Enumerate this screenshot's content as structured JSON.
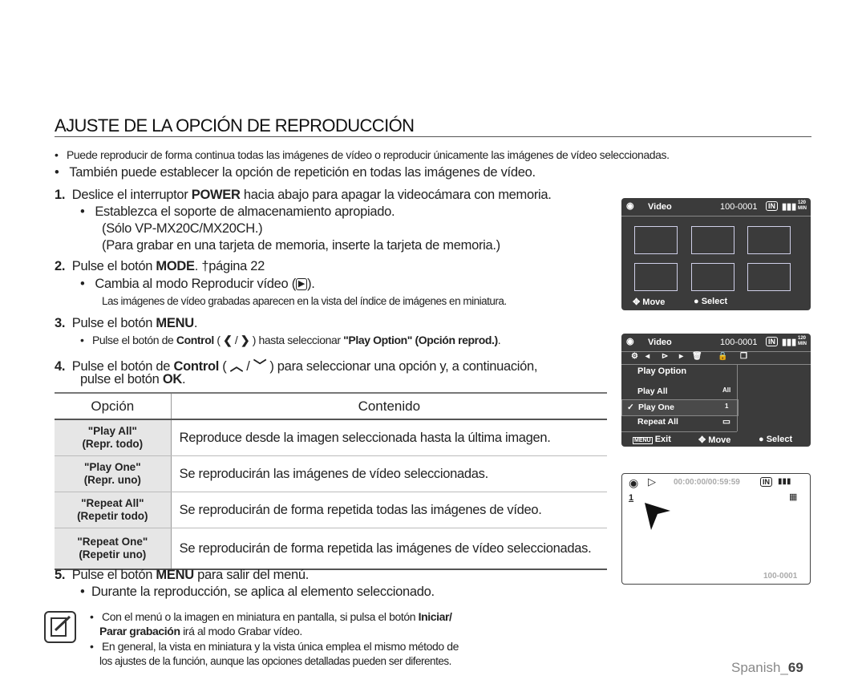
{
  "title": "AJUSTE DE LA OPCIÓN DE REPRODUCCIÓN",
  "intro": [
    "Puede reproducir de forma continua todas las imágenes de vídeo o reproducir únicamente las imágenes de vídeo seleccionadas.",
    "También puede establecer la opción de repetición en todas las imágenes de vídeo."
  ],
  "steps": {
    "s1": {
      "num": "1.",
      "pre": "Deslice el interruptor ",
      "key": "POWER",
      "post": " hacia abajo para apagar la videocámara con memoria.",
      "sub1": "Establezca el soporte de almacenamiento apropiado.",
      "sub2": "(Sólo VP-MX20C/MX20CH.)",
      "sub3": "(Para grabar en una tarjeta de memoria, inserte la tarjeta de memoria.)"
    },
    "s2": {
      "num": "2.",
      "pre": "Pulse el botón ",
      "key": "MODE",
      "post": ".  ",
      "ref": "página 22",
      "sub1": "Cambia al modo Reproducir vídeo (",
      "sub1b": ").",
      "sub2": "Las imágenes de vídeo grabadas aparecen en la vista del índice de imágenes en miniatura."
    },
    "s3": {
      "num": "3.",
      "pre": "Pulse el botón ",
      "key": "MENU",
      "post": ".",
      "sub_pre": "Pulse el botón de ",
      "sub_key": "Control",
      "sub_mid": " ( ",
      "sub_sep": " / ",
      "sub_post": " ) hasta seleccionar ",
      "sub_opt": "\"Play Option\" (Opción reprod.)",
      "sub_end": "."
    },
    "s4": {
      "num": "4.",
      "pre": "Pulse el botón de ",
      "key": "Control",
      "mid": " ( ",
      "sep": " / ",
      "post": " ) para seleccionar una opción y, a continuación,",
      "line2_pre": "pulse el botón ",
      "line2_key": "OK",
      "line2_post": "."
    },
    "s5": {
      "num": "5.",
      "pre": "Pulse el botón ",
      "key": "MENU",
      "post": " para salir del menú.",
      "sub1": "Durante la reproducción, se aplica al elemento seleccionado."
    }
  },
  "table": {
    "headers": [
      "Opción",
      "Contenido"
    ],
    "rows": [
      {
        "opt": "\"Play All\"",
        "opt2": "(Repr. todo)",
        "content": "Reproduce desde la imagen seleccionada hasta la última imagen."
      },
      {
        "opt": "\"Play One\"",
        "opt2": "(Repr. uno)",
        "content": "Se reproducirán las imágenes de vídeo seleccionadas."
      },
      {
        "opt": "\"Repeat All\"",
        "opt2": "(Repetir todo)",
        "content": "Se reproducirán de forma repetida todas las imágenes de vídeo."
      },
      {
        "opt": "\"Repeat One\"",
        "opt2": "(Repetir uno)",
        "content": "Se reproducirán de forma repetida las imágenes de vídeo seleccionadas."
      }
    ]
  },
  "notes": {
    "n1_pre": "Con el menú o la imagen en miniatura en pantalla, si pulsa el botón ",
    "n1_key": "Iniciar/",
    "n1_key2": "Parar grabación",
    "n1_post": " irá al modo Grabar vídeo.",
    "n2a": "En general, la vista en miniatura y la vista única emplea el mismo método de",
    "n2b": "los ajustes de la función, aunque las opciones detalladas pueden ser diferentes."
  },
  "screen1": {
    "mode": "Video",
    "file": "100-0001",
    "storage": "IN",
    "time": "120 MIN",
    "move": "Move",
    "select": "Select"
  },
  "screen2": {
    "mode": "Video",
    "file": "100-0001",
    "storage": "IN",
    "time": "120 MIN",
    "menu_title": "Play Option",
    "items": [
      {
        "label": "Play All",
        "icon": "All"
      },
      {
        "label": "Play One",
        "icon": "1"
      },
      {
        "label": "Repeat All",
        "icon": "repeat"
      }
    ],
    "selected": "Play One",
    "exit_key": "MENU",
    "exit": "Exit",
    "move": "Move",
    "select": "Select"
  },
  "screen3": {
    "timecode": "00:00:00/00:59:59",
    "storage": "IN",
    "option_icon": "1",
    "file": "100-0001"
  },
  "footer": {
    "lang": "Spanish_",
    "page": "69"
  }
}
